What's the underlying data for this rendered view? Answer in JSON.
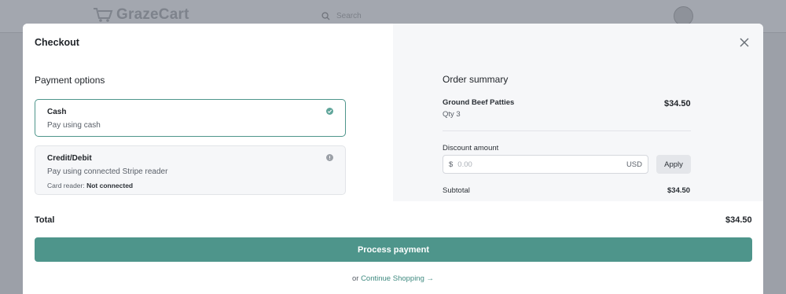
{
  "background": {
    "logo_text": "GrazeCart",
    "search_placeholder": "Search"
  },
  "modal": {
    "title": "Checkout",
    "close_icon": "close-icon"
  },
  "payment": {
    "title": "Payment options",
    "options": [
      {
        "name": "Cash",
        "description": "Pay using cash",
        "selected": true,
        "status_icon": "check-circle-icon"
      },
      {
        "name": "Credit/Debit",
        "description": "Pay using connected Stripe reader",
        "reader_label": "Card reader:",
        "reader_status": "Not connected",
        "selected": false,
        "status_icon": "info-circle-icon"
      }
    ]
  },
  "summary": {
    "title": "Order summary",
    "item": {
      "name": "Ground Beef Patties",
      "qty": "Qty 3",
      "price": "$34.50"
    },
    "discount": {
      "label": "Discount amount",
      "currency_symbol": "$",
      "placeholder": "0.00",
      "currency": "USD",
      "apply_label": "Apply"
    },
    "subtotal_label": "Subtotal",
    "subtotal_value": "$34.50"
  },
  "footer": {
    "total_label": "Total",
    "total_value": "$34.50",
    "process_label": "Process payment",
    "or_text": "or",
    "continue_label": "Continue Shopping →"
  },
  "colors": {
    "accent": "#4e958b",
    "overlay": "#9ca0a8",
    "panel": "#f6f7f9"
  }
}
